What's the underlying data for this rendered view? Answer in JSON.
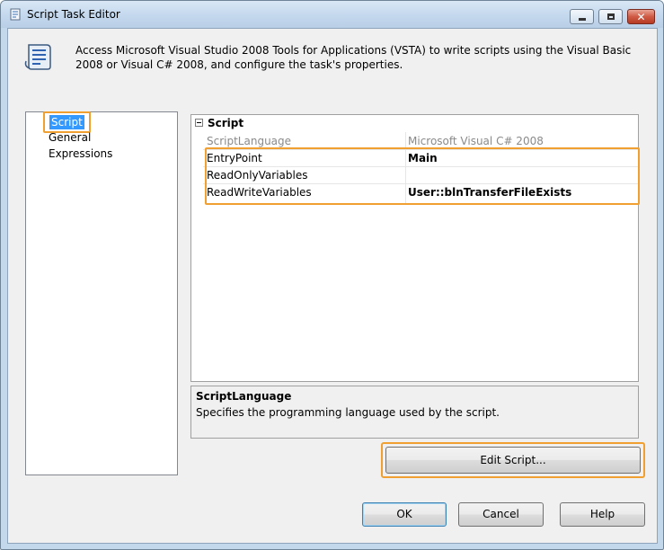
{
  "window": {
    "title": "Script Task Editor"
  },
  "header": {
    "description": "Access Microsoft Visual Studio 2008 Tools for Applications (VSTA) to write scripts using the Visual Basic 2008 or Visual C# 2008, and configure the task's properties."
  },
  "nav": {
    "items": [
      {
        "label": "Script",
        "selected": true
      },
      {
        "label": "General",
        "selected": false
      },
      {
        "label": "Expressions",
        "selected": false
      }
    ]
  },
  "properties": {
    "category": "Script",
    "rows": [
      {
        "name": "ScriptLanguage",
        "value": "Microsoft Visual C# 2008",
        "state": "disabled"
      },
      {
        "name": "EntryPoint",
        "value": "Main"
      },
      {
        "name": "ReadOnlyVariables",
        "value": ""
      },
      {
        "name": "ReadWriteVariables",
        "value": "User::blnTransferFileExists"
      }
    ]
  },
  "description_panel": {
    "title": "ScriptLanguage",
    "text": "Specifies the programming language used by the script."
  },
  "buttons": {
    "edit_script": "Edit Script...",
    "ok": "OK",
    "cancel": "Cancel",
    "help": "Help"
  },
  "colors": {
    "highlight_frame": "#f0a030",
    "selection": "#3399ff"
  }
}
